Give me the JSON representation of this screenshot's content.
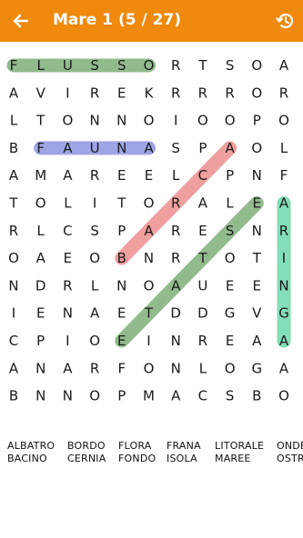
{
  "header": {
    "title": "Mare 1 (5 / 27)",
    "back_icon": "arrow-left-icon",
    "history_icon": "history-icon",
    "color": "#ef8a0e"
  },
  "grid": {
    "rows": [
      "FLUSSORTSOA",
      "AVIREKRRROR",
      "LTONNOIOOPO",
      "BFAUNASPAOL",
      "AMAREELCPNF",
      "TOLITORALEA",
      "RLCSPARESNR",
      "OAEOBNRTOTI",
      "NDRLNOAUEEN",
      "IENAETDDGVG",
      "CPIOEINREAA",
      "ANARFONLOGA",
      "BNNOPMACSBO"
    ],
    "found": [
      {
        "word": "FLUSSO",
        "color": "#7fb07a",
        "start": [
          0,
          0
        ],
        "end": [
          0,
          5
        ]
      },
      {
        "word": "FAUNA",
        "color": "#8c96e0",
        "start": [
          3,
          1
        ],
        "end": [
          3,
          5
        ]
      },
      {
        "word": "BARCA",
        "color": "#ee8f8f",
        "start": [
          7,
          4
        ],
        "end": [
          3,
          8
        ]
      },
      {
        "word": "ARINGA",
        "color": "#6fd9ad",
        "start": [
          5,
          10
        ],
        "end": [
          10,
          10
        ]
      },
      {
        "word": "ETNEE",
        "color": "#7fb07a",
        "start": [
          10,
          4
        ],
        "end": [
          5,
          9
        ]
      }
    ]
  },
  "words": [
    [
      "ALBATRO",
      "BACINO"
    ],
    [
      "BORDO",
      "CERNIA"
    ],
    [
      "FLORA",
      "FONDO"
    ],
    [
      "FRANA",
      "ISOLA"
    ],
    [
      "LITORALE",
      "MAREE"
    ],
    [
      "ONDE",
      "OSTR"
    ]
  ]
}
